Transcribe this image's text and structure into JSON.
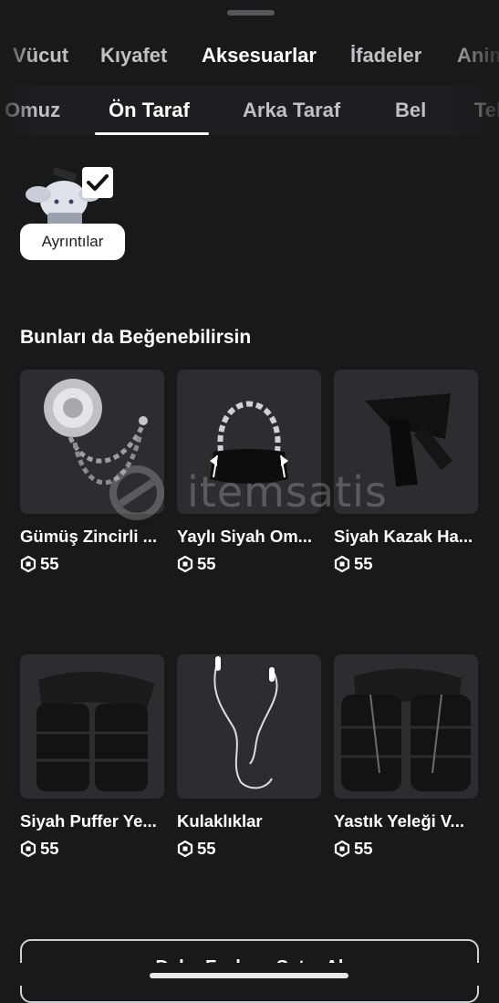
{
  "main_tabs": [
    "Vücut",
    "Kıyafet",
    "Aksesuarlar",
    "İfadeler",
    "Animasyonlar"
  ],
  "main_active": "Aksesuarlar",
  "sub_tabs": [
    "Omuz",
    "Ön Taraf",
    "Arka Taraf",
    "Bel",
    "Tekrar"
  ],
  "sub_active": "Ön Taraf",
  "equipped": {
    "checked": true,
    "details_label": "Ayrıntılar"
  },
  "recommendations": {
    "title": "Bunları da Beğenebilirsin",
    "items": [
      {
        "name": "Gümüş Zincirli ...",
        "price": "55",
        "icon": "silver-rose-chain-icon"
      },
      {
        "name": "Yaylı Siyah Om...",
        "price": "55",
        "icon": "black-bag-icon"
      },
      {
        "name": "Siyah Kazak Ha...",
        "price": "55",
        "icon": "black-sweater-icon"
      },
      {
        "name": "Siyah Puffer Ye...",
        "price": "55",
        "icon": "puffer-vest-icon"
      },
      {
        "name": "Kulaklıklar",
        "price": "55",
        "icon": "earphones-icon"
      },
      {
        "name": "Yastık Yeleği V...",
        "price": "55",
        "icon": "pillow-vest-icon"
      }
    ]
  },
  "watermark": "itemsatis",
  "bottom_button": "Daha Fazla ... Satın Al",
  "colors": {
    "background": "#18191b",
    "card": "#2c2d30",
    "accent": "#ffffff",
    "inactive_tab": "#bfc0c3"
  }
}
